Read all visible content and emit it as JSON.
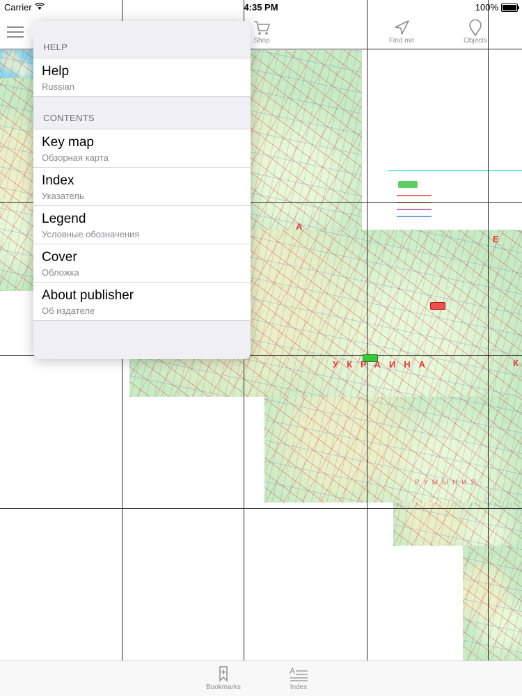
{
  "status_bar": {
    "carrier": "Carrier",
    "time": "4:35 PM",
    "battery": "100%"
  },
  "toolbar": {
    "menu_icon": "hamburger-menu-icon",
    "shop_label": "Shop",
    "find_me_label": "Find me",
    "objects_label": "Objects"
  },
  "map": {
    "country_label": "УКРАИНА",
    "region_label": "РУМЫНИЯ",
    "letter_a": "А",
    "letter_e": "Е",
    "letter_k": "К"
  },
  "popover": {
    "sections": [
      {
        "header": "HELP",
        "items": [
          {
            "title": "Help",
            "subtitle": "Russian"
          }
        ]
      },
      {
        "header": "CONTENTS",
        "items": [
          {
            "title": "Key map",
            "subtitle": "Обзорная карта"
          },
          {
            "title": "Index",
            "subtitle": "Указатель"
          },
          {
            "title": "Legend",
            "subtitle": "Условные обозначения"
          },
          {
            "title": "Cover",
            "subtitle": "Обложка"
          },
          {
            "title": "About publisher",
            "subtitle": "Об издателе"
          }
        ]
      }
    ]
  },
  "tab_bar": {
    "bookmarks_label": "Bookmarks",
    "index_label": "Index"
  },
  "colors": {
    "accent_gray": "#8d8d8d",
    "map_land": "#c8ebc6",
    "map_sea": "#8fd6ec",
    "popover_bg": "#efeff4"
  }
}
